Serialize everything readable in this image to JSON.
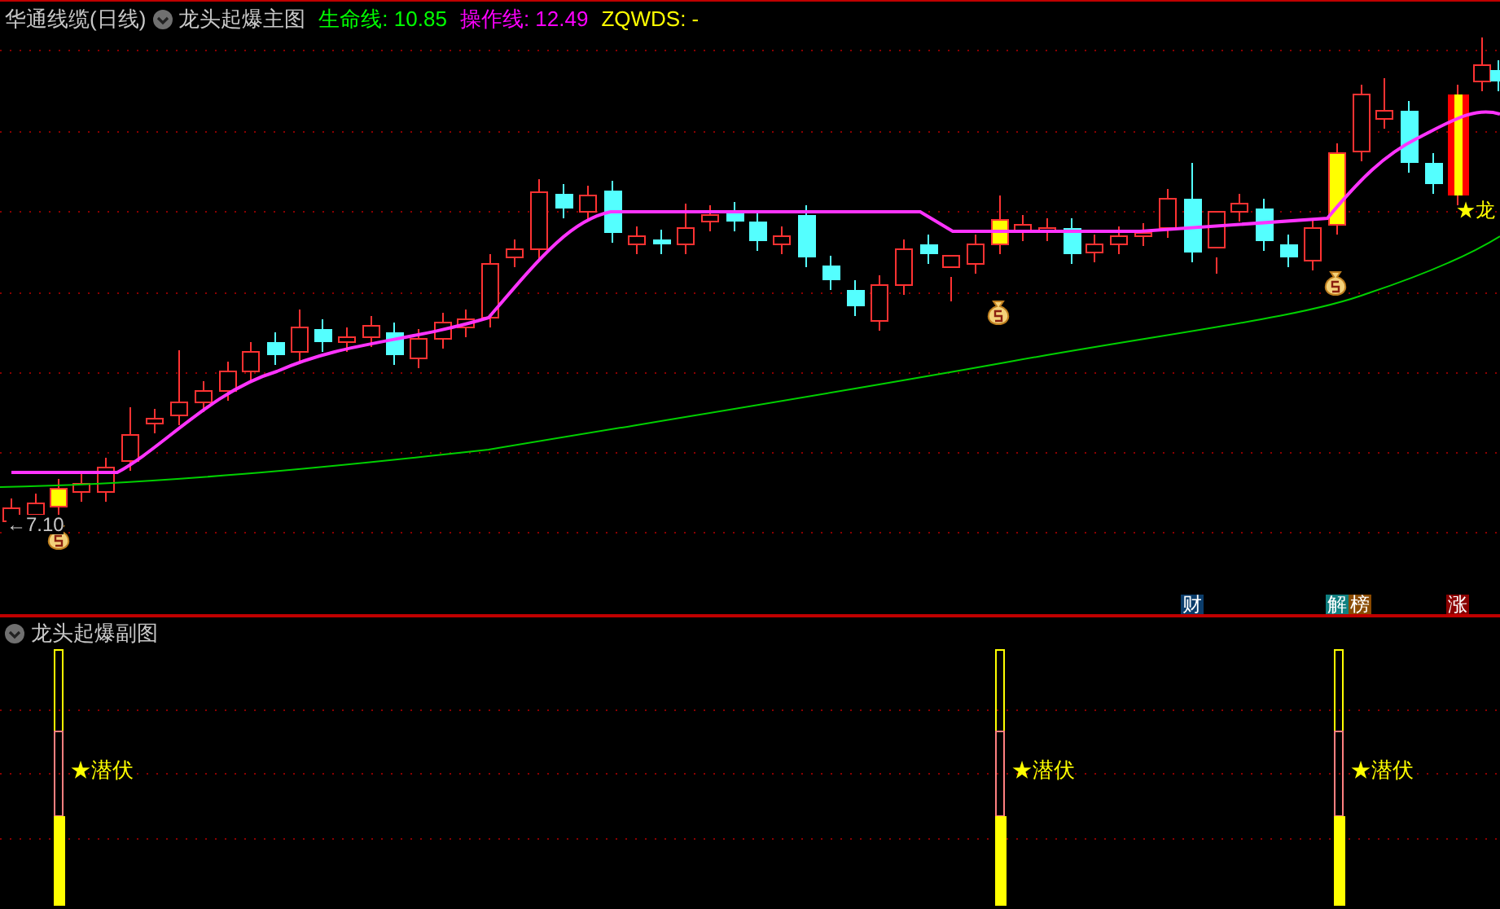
{
  "header": {
    "instrument": "华通线缆(日线)",
    "indicator": "龙头起爆主图",
    "readings": [
      {
        "label": "生命线:",
        "value": "10.85",
        "color": "#00ff00"
      },
      {
        "label": "操作线:",
        "value": "12.49",
        "color": "#ff00ff"
      },
      {
        "label": "ZQWDS:",
        "value": "-",
        "color": "#ffff00"
      }
    ]
  },
  "main_chart": {
    "price_label": "←7.10",
    "signal_label": "★龙",
    "badges": [
      {
        "text": "财",
        "color": "#0b3d6b"
      },
      {
        "text": "解",
        "color": "#0f7f80"
      },
      {
        "text": "榜",
        "color": "#8a4a00"
      },
      {
        "text": "涨",
        "color": "#8b0000"
      }
    ]
  },
  "sub_chart": {
    "title": "龙头起爆副图",
    "signals": [
      "★潜伏",
      "★潜伏",
      "★潜伏"
    ]
  }
}
